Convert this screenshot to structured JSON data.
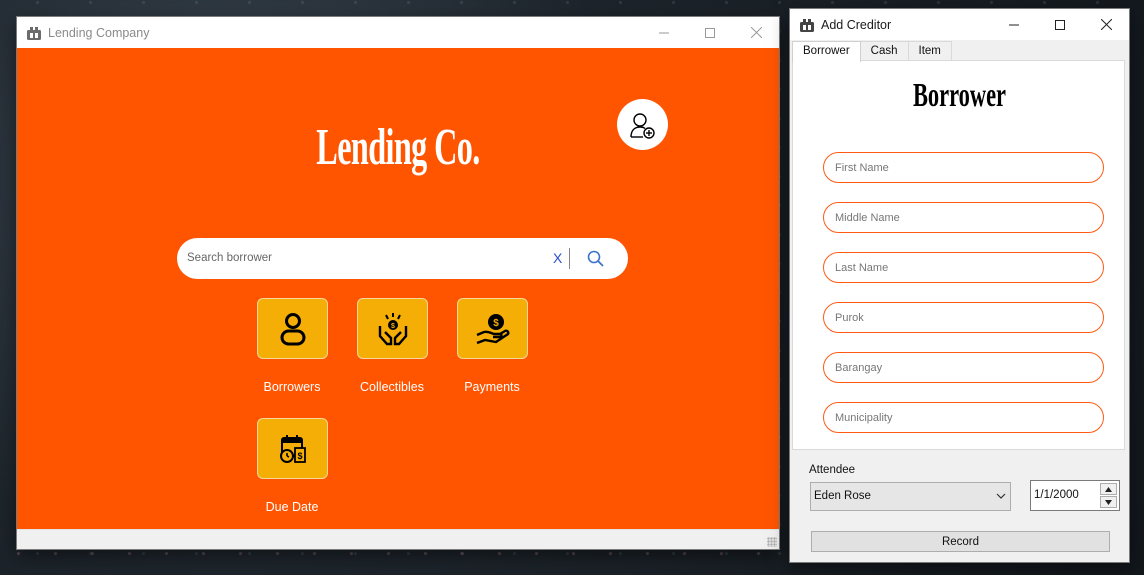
{
  "main_window": {
    "title": "Lending Company",
    "brand": "Lending Co.",
    "search": {
      "placeholder": "Search borrower",
      "value": "",
      "clear_label": "X"
    },
    "tiles": [
      {
        "label": "Borrowers",
        "icon": "user-icon"
      },
      {
        "label": "Collectibles",
        "icon": "money-collect-icon"
      },
      {
        "label": "Payments",
        "icon": "hand-coin-icon"
      },
      {
        "label": "Due Date",
        "icon": "calendar-bill-icon"
      }
    ]
  },
  "dialog": {
    "title": "Add Creditor",
    "tabs": [
      {
        "label": "Borrower",
        "active": true
      },
      {
        "label": "Cash",
        "active": false
      },
      {
        "label": "Item",
        "active": false
      }
    ],
    "heading": "Borrower",
    "fields": {
      "first_name": "First Name",
      "middle_name": "Middle Name",
      "last_name": "Last Name",
      "purok": "Purok",
      "barangay": "Barangay",
      "municipality": "Municipality"
    },
    "attendee_label": "Attendee",
    "attendee_value": "Eden Rose",
    "date_value": "1/1/2000",
    "record_label": "Record"
  },
  "colors": {
    "accent": "#ff5500",
    "tile": "#f5ae06",
    "field_border": "#ff5a14"
  }
}
